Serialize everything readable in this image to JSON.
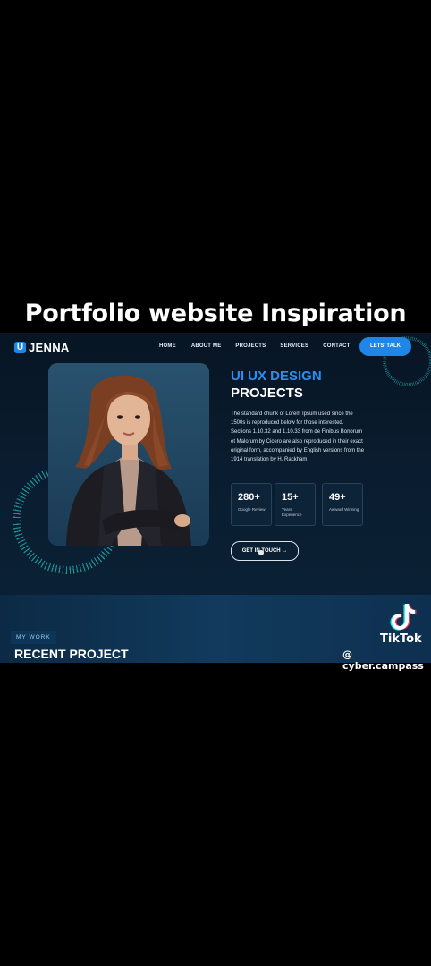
{
  "caption": "Portfolio website Inspiration",
  "site": {
    "logo": {
      "mark": "U",
      "text": "JENNA"
    },
    "nav": [
      {
        "label": "HOME",
        "active": false
      },
      {
        "label": "ABOUT ME",
        "active": true
      },
      {
        "label": "PROJECTS",
        "active": false
      },
      {
        "label": "SERVICES",
        "active": false
      },
      {
        "label": "CONTACT",
        "active": false
      }
    ],
    "cta_label": "LETS' TALK",
    "hero": {
      "heading_accent": "UI UX DESIGN",
      "heading": "PROJECTS",
      "paragraph": "The standard chunk of Lorem Ipsum used since the 1500s is reproduced below for those interested. Sections 1.10.32 and 1.10.33 from de Finibus Bonorum et Malorum by Cicero are also reproduced in their exact original form, accompanied by English versions from the 1914 translation by H. Rackham.",
      "stats": [
        {
          "value": "280+",
          "label": "Google Review"
        },
        {
          "value": "15+",
          "label": "Years Experience"
        },
        {
          "value": "49+",
          "label": "Awward Winning"
        }
      ],
      "button": "GET IN TOUCH  →"
    },
    "work": {
      "badge": "MY WORK",
      "title": "RECENT PROJECT"
    },
    "colors": {
      "accent": "#1f86e8",
      "teal": "#1fa5a8",
      "bg": "#071524"
    }
  },
  "watermark": {
    "name": "TikTok",
    "handle": "@ cyber.campass",
    "icon": "tiktok-icon"
  }
}
